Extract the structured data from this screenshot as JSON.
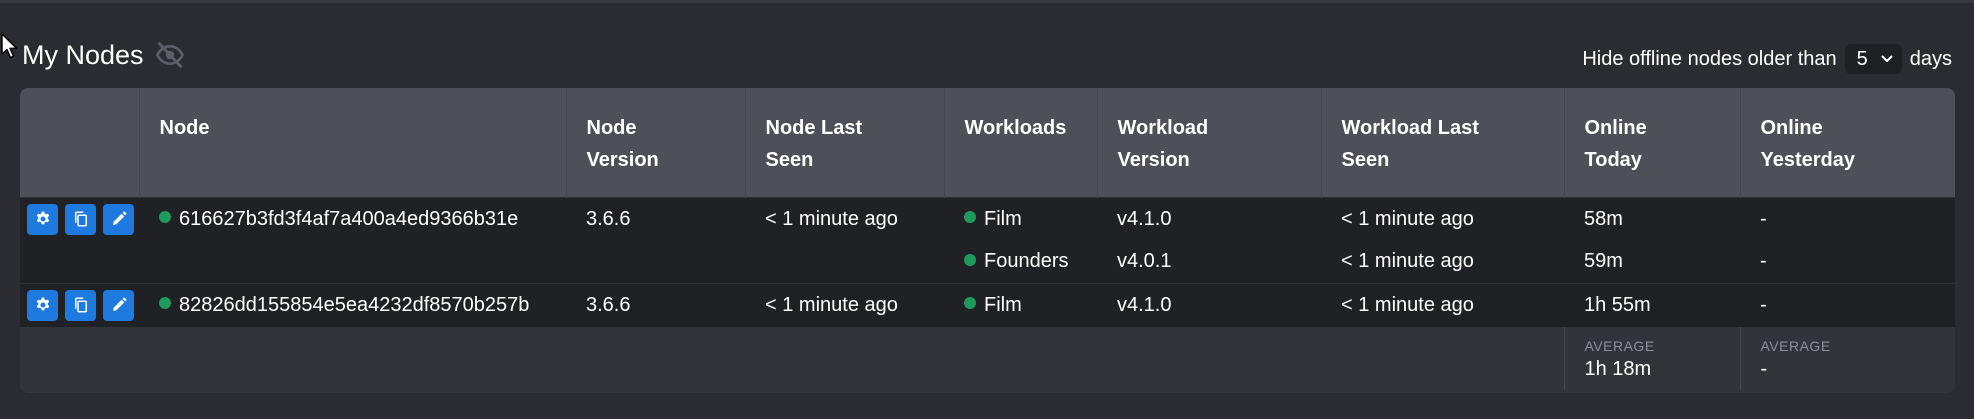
{
  "header": {
    "title": "My Nodes"
  },
  "filter": {
    "prefix": "Hide offline nodes older than",
    "value": "5",
    "suffix": "days"
  },
  "table": {
    "columns": [
      "",
      "Node",
      "Node Version",
      "Node Last Seen",
      "Workloads",
      "Workload Version",
      "Workload Last Seen",
      "Online Today",
      "Online Yesterday"
    ],
    "nodes": [
      {
        "id": "616627b3fd3f4af7a400a4ed9366b31e",
        "version": "3.6.6",
        "last_seen": "< 1 minute ago",
        "workloads": [
          {
            "name": "Film",
            "version": "v4.1.0",
            "last_seen": "< 1 minute ago",
            "online_today": "58m",
            "online_yesterday": "-"
          },
          {
            "name": "Founders",
            "version": "v4.0.1",
            "last_seen": "< 1 minute ago",
            "online_today": "59m",
            "online_yesterday": "-"
          }
        ]
      },
      {
        "id": "82826dd155854e5ea4232df8570b257b",
        "version": "3.6.6",
        "last_seen": "< 1 minute ago",
        "workloads": [
          {
            "name": "Film",
            "version": "v4.1.0",
            "last_seen": "< 1 minute ago",
            "online_today": "1h 55m",
            "online_yesterday": "-"
          }
        ]
      }
    ],
    "summary": {
      "today_label": "AVERAGE",
      "today_value": "1h 18m",
      "yesterday_label": "AVERAGE",
      "yesterday_value": "-"
    }
  },
  "icons": {
    "visibility": "eye-off-icon",
    "settings": "gear-icon",
    "copy": "copy-icon",
    "edit": "pencil-icon",
    "status": "online-dot-icon"
  },
  "colors": {
    "accent": "#1f7ae0",
    "online": "#1e9a5c",
    "header_bg": "#4e5058",
    "row_bg": "#202125"
  }
}
